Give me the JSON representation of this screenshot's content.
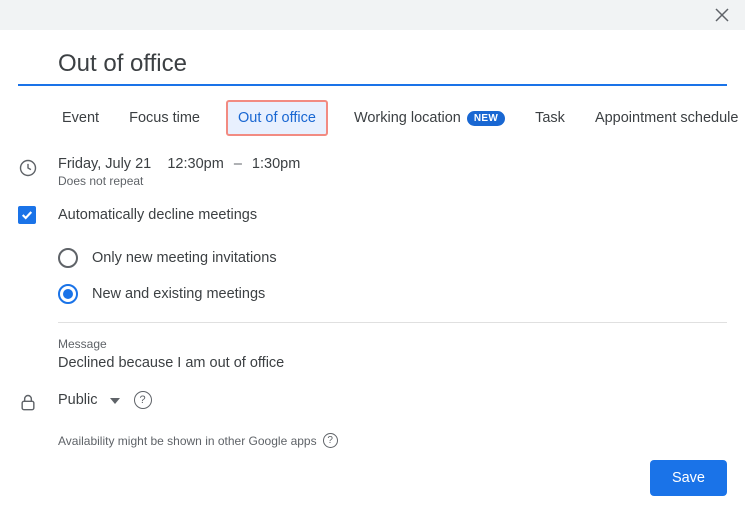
{
  "title": "Out of office",
  "tabs": {
    "event": "Event",
    "focus_time": "Focus time",
    "out_of_office": "Out of office",
    "working_location": "Working location",
    "working_location_badge": "NEW",
    "task": "Task",
    "appointment_schedule": "Appointment schedule"
  },
  "datetime": {
    "date": "Friday, July 21",
    "start": "12:30pm",
    "end": "1:30pm",
    "repeat": "Does not repeat"
  },
  "decline": {
    "checkbox_label": "Automatically decline meetings",
    "option_only_new": "Only new meeting invitations",
    "option_new_and_existing": "New and existing meetings"
  },
  "message": {
    "label": "Message",
    "value": "Declined because I am out of office"
  },
  "visibility": {
    "value": "Public",
    "note": "Availability might be shown in other Google apps"
  },
  "actions": {
    "save": "Save"
  }
}
